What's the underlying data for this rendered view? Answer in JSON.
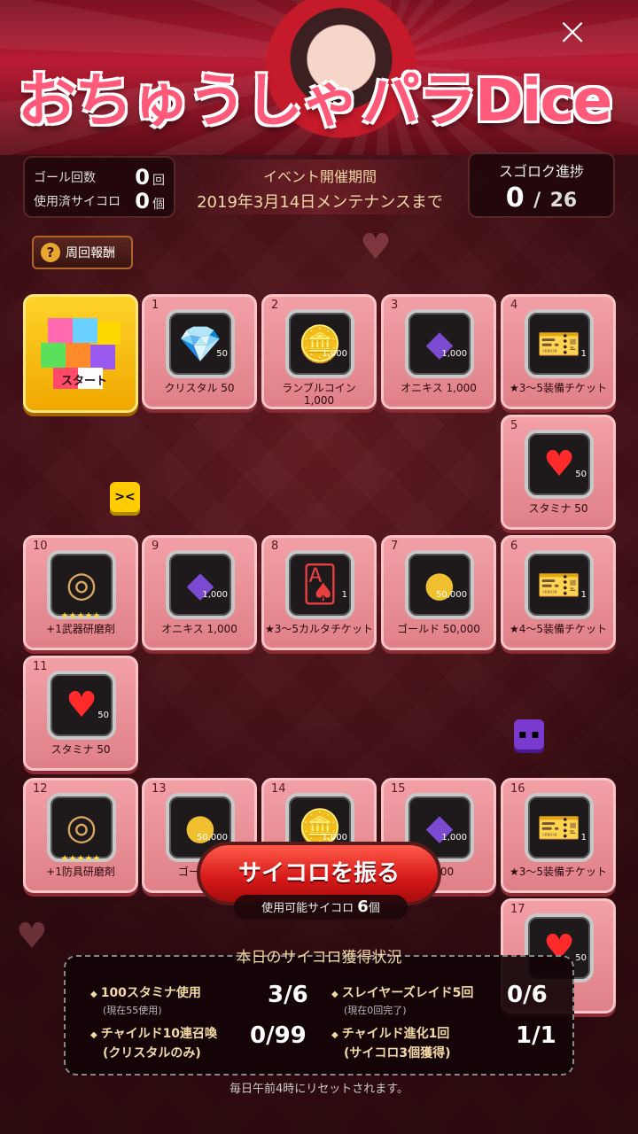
{
  "banner": {
    "title_left": "おちゅうしゃ",
    "title_right": "パラDice"
  },
  "stats": {
    "goal_label": "ゴール回数",
    "goal_value": "0",
    "goal_unit": "回",
    "dice_used_label": "使用済サイコロ",
    "dice_used_value": "0",
    "dice_used_unit": "個"
  },
  "event": {
    "heading": "イベント開催期間",
    "date": "2019年3月14日メンテナンスまで"
  },
  "progress": {
    "heading": "スゴロク進捗",
    "current": "0",
    "separator": "/",
    "total": "26"
  },
  "lap_reward_label": "周回報酬",
  "start_label": "スタート",
  "tiles": [
    {
      "num": "1",
      "label": "クリスタル 50",
      "qty": "50",
      "icon": "crystal-icon"
    },
    {
      "num": "2",
      "label": "ランブルコイン\n1,000",
      "qty": "1,000",
      "icon": "rumble-coin-icon"
    },
    {
      "num": "3",
      "label": "オニキス 1,000",
      "qty": "1,000",
      "icon": "onyx-icon"
    },
    {
      "num": "4",
      "label": "★3～5装備チケット",
      "qty": "1",
      "icon": "equipment-ticket-icon"
    },
    {
      "num": "5",
      "label": "スタミナ 50",
      "qty": "50",
      "icon": "stamina-heart-icon"
    },
    {
      "num": "6",
      "label": "★4～5装備チケット",
      "qty": "1",
      "icon": "equipment-ticket-icon"
    },
    {
      "num": "7",
      "label": "ゴールド 50,000",
      "qty": "50,000",
      "icon": "gold-icon"
    },
    {
      "num": "8",
      "label": "★3～5カルタチケット",
      "qty": "1",
      "icon": "karta-ticket-icon"
    },
    {
      "num": "9",
      "label": "オニキス 1,000",
      "qty": "1,000",
      "icon": "onyx-icon"
    },
    {
      "num": "10",
      "label": "+1武器研磨剤",
      "qty": "",
      "icon": "weapon-polish-icon",
      "stars": "★★★★★"
    },
    {
      "num": "11",
      "label": "スタミナ 50",
      "qty": "50",
      "icon": "stamina-heart-icon"
    },
    {
      "num": "12",
      "label": "+1防具研磨剤",
      "qty": "",
      "icon": "armor-polish-icon",
      "stars": "★★★★★"
    },
    {
      "num": "13",
      "label": "ゴールド",
      "qty": "50,000",
      "icon": "gold-icon"
    },
    {
      "num": "14",
      "label": "",
      "qty": "1,000",
      "icon": "rumble-coin-icon"
    },
    {
      "num": "15",
      "label": "1,000",
      "qty": "1,000",
      "icon": "onyx-icon"
    },
    {
      "num": "16",
      "label": "★3～5装備チケット",
      "qty": "1",
      "icon": "equipment-ticket-icon"
    },
    {
      "num": "17",
      "label": "",
      "qty": "50",
      "icon": "stamina-heart-icon"
    }
  ],
  "roll": {
    "button_label": "サイコロを振る",
    "available_label": "使用可能サイコロ",
    "available_value": "6",
    "available_unit": "個"
  },
  "daily": {
    "title": "本日のサイコロ獲得状況",
    "tasks": [
      {
        "title": "100スタミナ使用",
        "sub": "(現在55使用)",
        "value": "3/6"
      },
      {
        "title": "スレイヤーズレイド5回",
        "sub": "(現在0回完了)",
        "value": "0/6"
      },
      {
        "title": "チャイルド10連召喚",
        "sub": "(クリスタルのみ)",
        "value": "0/99"
      },
      {
        "title": "チャイルド進化1回",
        "sub": "(サイコロ3個獲得)",
        "value": "1/1"
      }
    ]
  },
  "footer": "毎日午前4時にリセットされます。",
  "colors": {
    "background": "#4a161c",
    "tile": "#f2a0a6",
    "start_tile": "#ffd32a",
    "roll_button": "#d41818",
    "accent_text": "#f2d9a6"
  }
}
